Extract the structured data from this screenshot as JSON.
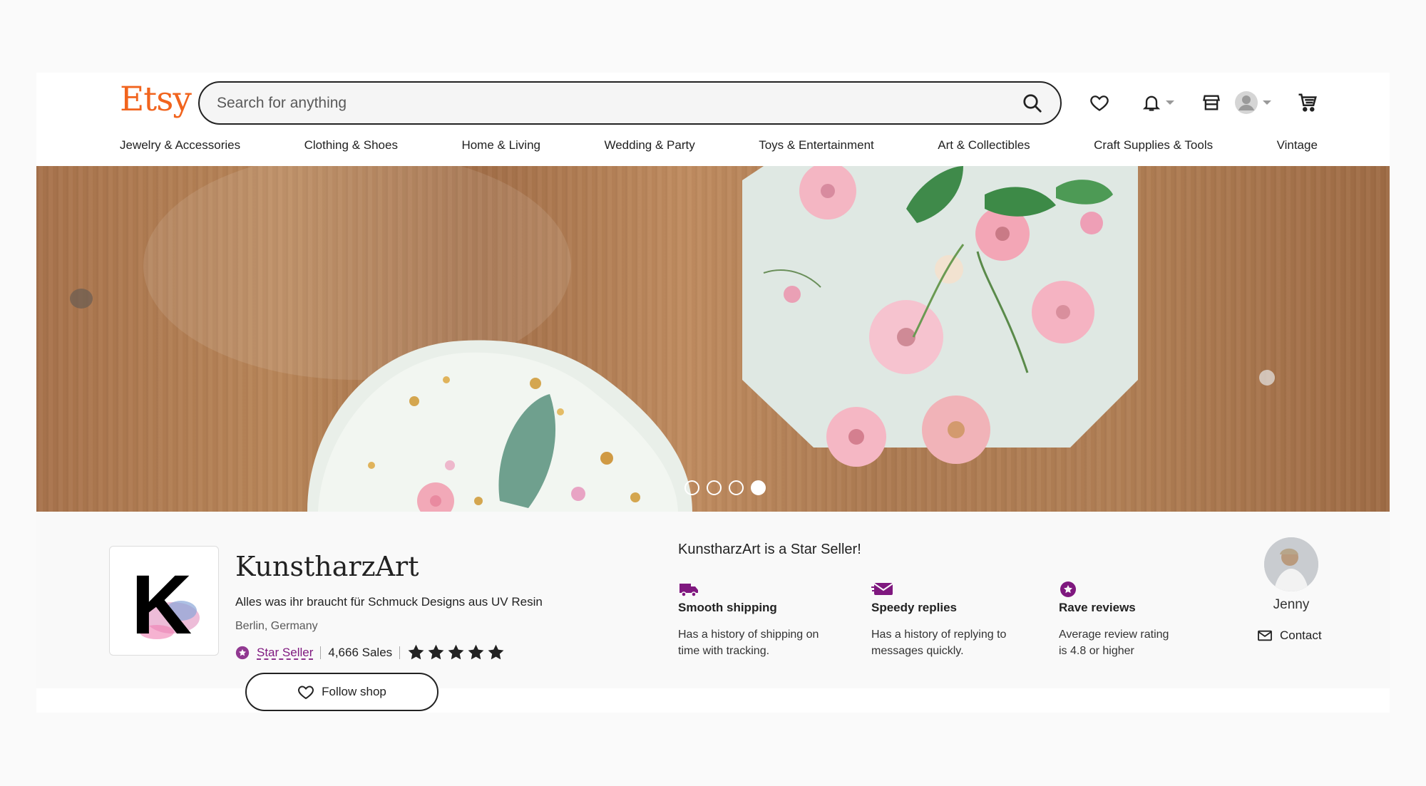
{
  "header": {
    "logo": "Etsy",
    "search_placeholder": "Search for anything",
    "brand_color": "#f1641e"
  },
  "nav": {
    "categories": [
      "Jewelry & Accessories",
      "Clothing & Shoes",
      "Home & Living",
      "Wedding & Party",
      "Toys & Entertainment",
      "Art & Collectibles",
      "Craft Supplies & Tools",
      "Vintage"
    ]
  },
  "hero": {
    "slide_count": 4,
    "active_slide": 4
  },
  "shop": {
    "name": "KunstharzArt",
    "logo_letter": "K",
    "description": "Alles was ihr braucht für Schmuck Designs aus UV Resin",
    "location": "Berlin, Germany",
    "star_seller_label": "Star Seller",
    "sales": "4,666 Sales",
    "rating_stars": 5,
    "follow_label": "Follow shop"
  },
  "star_seller": {
    "title": "KunstharzArt is a Star Seller!",
    "accent_color": "#7f187f",
    "features": [
      {
        "icon": "truck-icon",
        "title": "Smooth shipping",
        "desc_line1": "Has a history of shipping on",
        "desc_line2": "time with tracking."
      },
      {
        "icon": "message-icon",
        "title": "Speedy replies",
        "desc_line1": "Has a history of replying to",
        "desc_line2": "messages quickly."
      },
      {
        "icon": "star-badge-icon",
        "title": "Rave reviews",
        "desc_line1": "Average review rating",
        "desc_line2": "is 4.8 or higher"
      }
    ]
  },
  "owner": {
    "name": "Jenny",
    "contact_label": "Contact"
  }
}
